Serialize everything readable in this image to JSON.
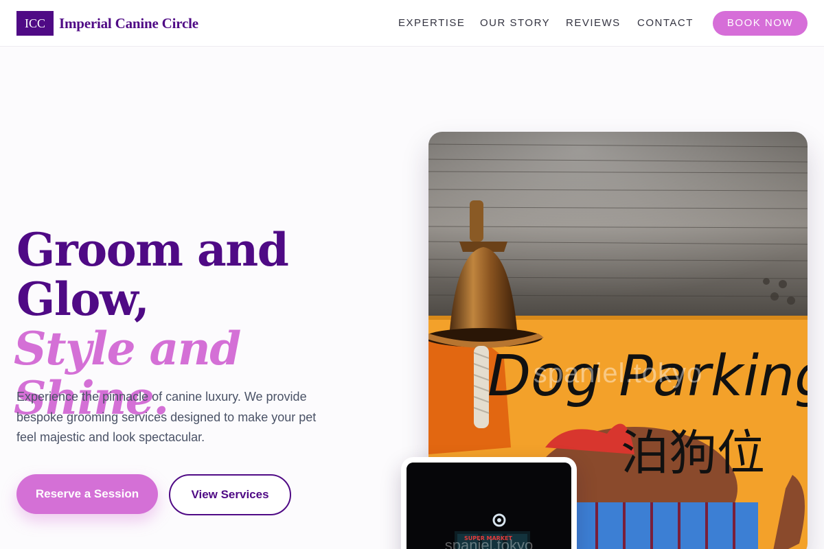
{
  "header": {
    "logo_text": "ICC",
    "brand_name": "Imperial Canine Circle",
    "nav": [
      "EXPERTISE",
      "OUR STORY",
      "REVIEWS",
      "CONTACT"
    ],
    "cta_label": "BOOK NOW"
  },
  "hero": {
    "headline_line1": "Groom and",
    "headline_line2": "Glow,",
    "headline_accent": "Style and Shine.",
    "lede": "Experience the pinnacle of canine luxury. We provide bespoke grooming services designed to make your pet feel majestic and look spectacular.",
    "primary_button": "Reserve a Session",
    "secondary_button": "View Services"
  },
  "hero_image": {
    "sign_text": "Dog Parking",
    "sign_cjk": "泊狗位",
    "watermark": "spaniel.tokyo"
  },
  "inset_image": {
    "store_sign": "SUPER MARKET",
    "watermark": "spaniel.tokyo"
  },
  "colors": {
    "brand_purple": "#4f0a85",
    "accent_pink": "#d470d6",
    "sign_orange": "#f3a12a"
  }
}
